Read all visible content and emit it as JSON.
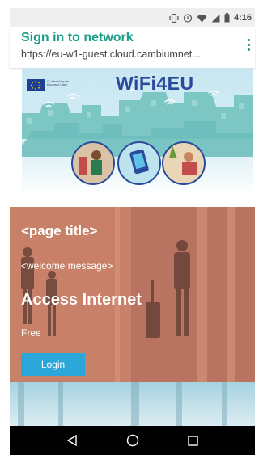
{
  "status_bar": {
    "time": "4:16",
    "icons": [
      "vibrate-icon",
      "alarm-icon",
      "wifi-icon",
      "signal-icon",
      "battery-icon"
    ]
  },
  "header": {
    "title": "Sign in to network",
    "url": "https://eu-w1-guest.cloud.cambiumnet..."
  },
  "banner": {
    "logo_caption": "Co-funded by the European Union",
    "brand": "WiFi4EU"
  },
  "content": {
    "page_title": "<page title>",
    "welcome_message": "<welcome message>",
    "heading": "Access Internet",
    "plan": "Free",
    "login_label": "Login"
  },
  "nav": {
    "icons": [
      "back-icon",
      "home-icon",
      "recents-icon"
    ]
  },
  "colors": {
    "accent": "#1a9e8a",
    "button": "#2aa6d8",
    "overlay": "#c97d66",
    "brand": "#2a4b9b"
  }
}
